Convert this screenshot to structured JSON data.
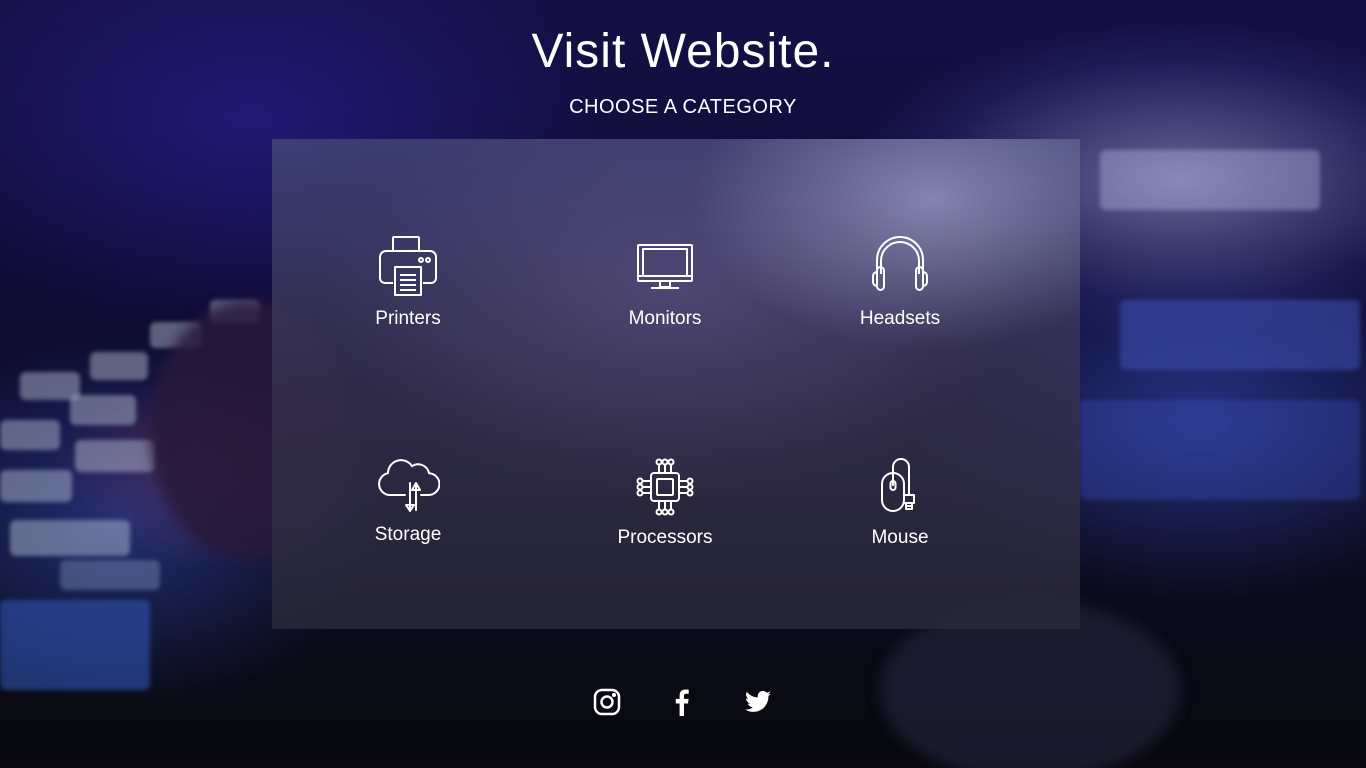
{
  "page": {
    "title": "Visit Website.",
    "subtitle": "CHOOSE A CATEGORY"
  },
  "categories": [
    {
      "label": "Printers",
      "icon": "printer-icon"
    },
    {
      "label": "Monitors",
      "icon": "monitor-icon"
    },
    {
      "label": "Headsets",
      "icon": "headset-icon"
    },
    {
      "label": "Storage",
      "icon": "cloud-storage-icon"
    },
    {
      "label": "Processors",
      "icon": "processor-chip-icon"
    },
    {
      "label": "Mouse",
      "icon": "mouse-icon"
    }
  ],
  "social": [
    {
      "icon": "instagram-icon"
    },
    {
      "icon": "facebook-icon"
    },
    {
      "icon": "twitter-icon"
    }
  ],
  "colors": {
    "text": "#ffffff",
    "background": "#0b0b1a",
    "panel": "#46496e"
  }
}
